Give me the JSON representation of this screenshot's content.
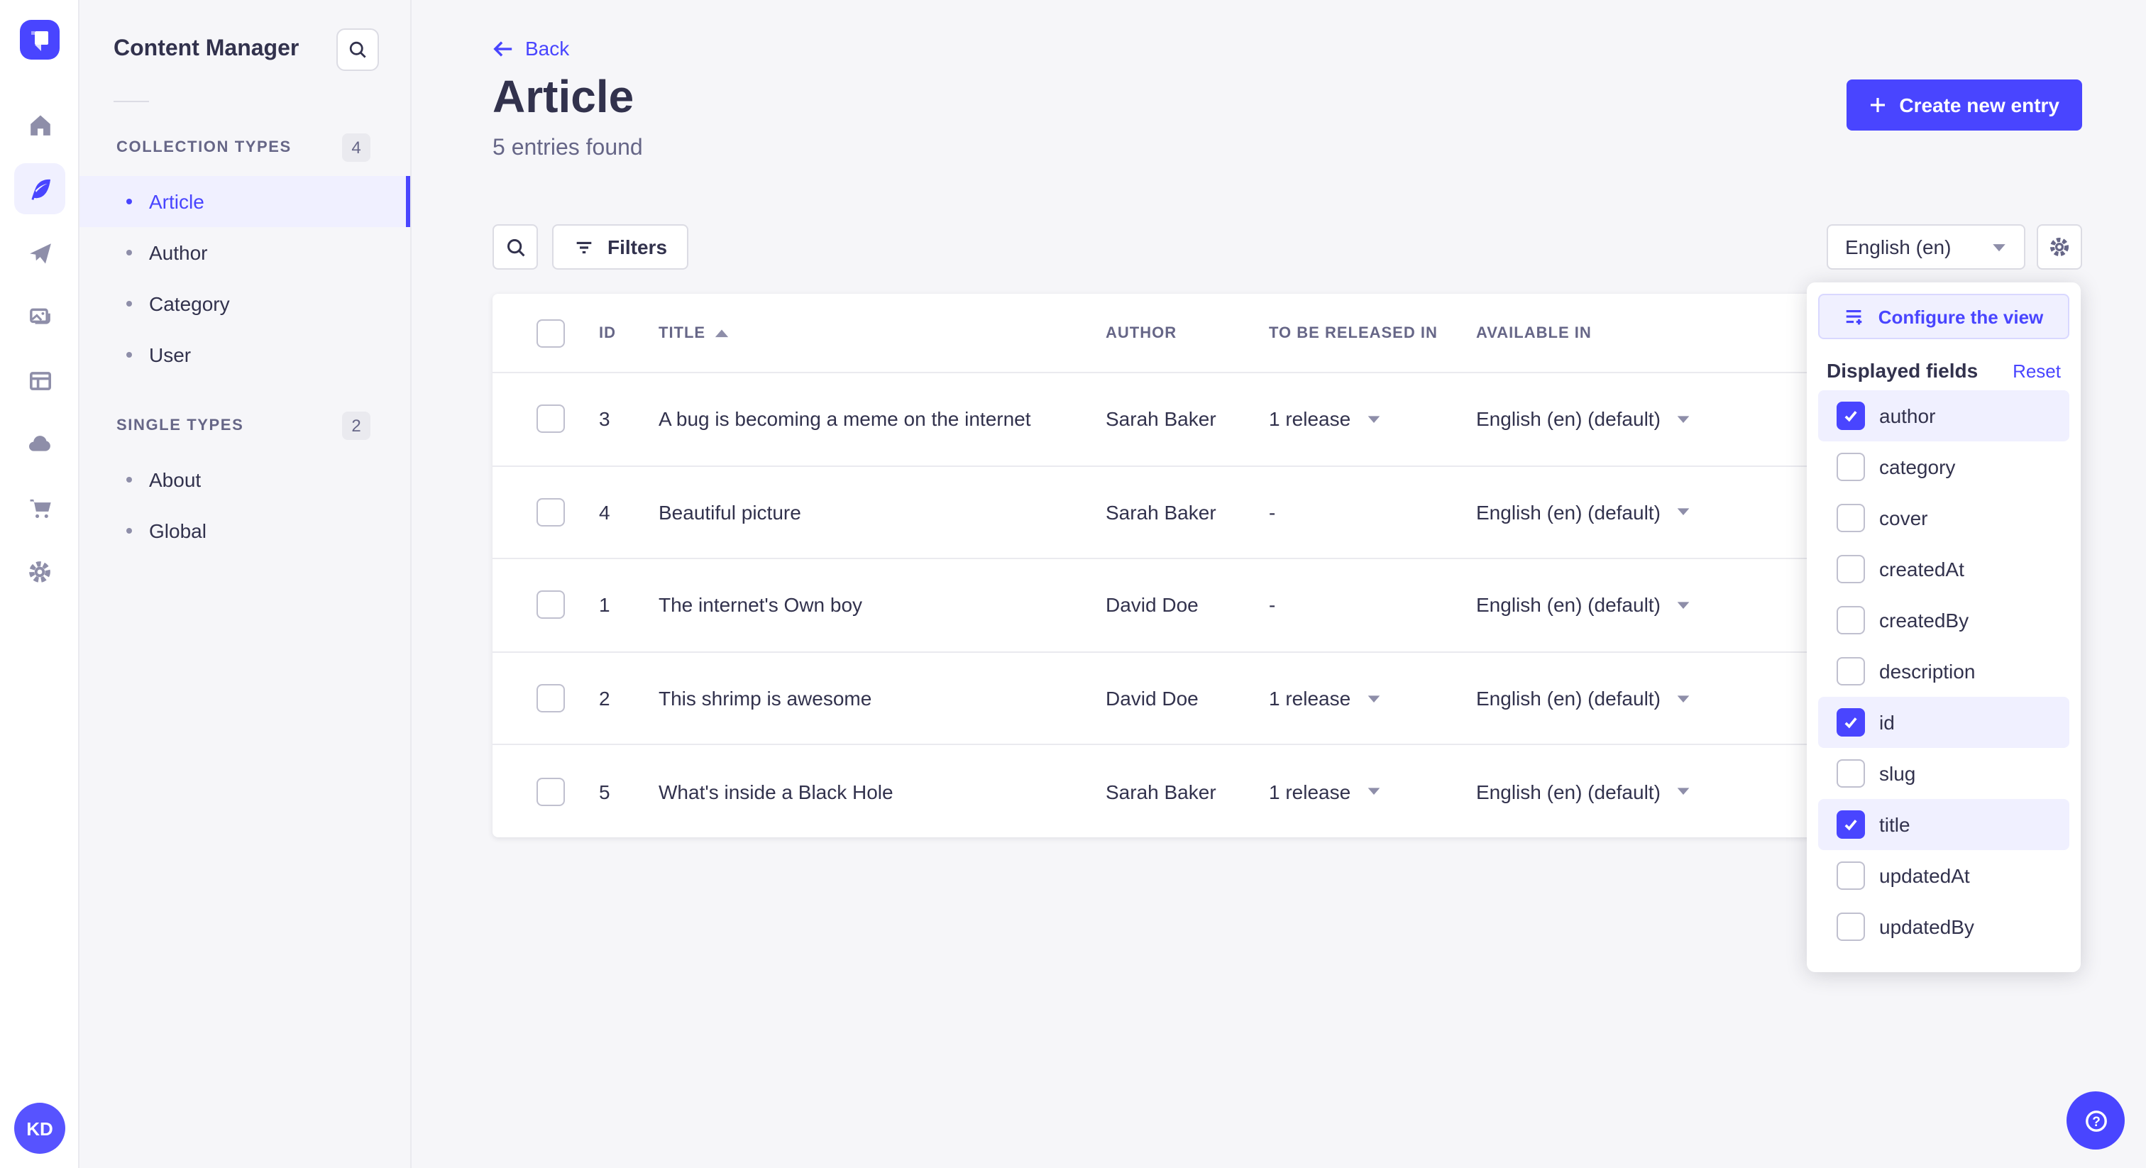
{
  "panel": {
    "title": "Content Manager",
    "collection_types": {
      "label": "COLLECTION TYPES",
      "badge": "4",
      "items": [
        {
          "label": "Article",
          "active": true
        },
        {
          "label": "Author"
        },
        {
          "label": "Category"
        },
        {
          "label": "User"
        }
      ]
    },
    "single_types": {
      "label": "SINGLE TYPES",
      "badge": "2",
      "items": [
        {
          "label": "About"
        },
        {
          "label": "Global"
        }
      ]
    }
  },
  "rail": {
    "icons": [
      "strapi-logo",
      "home",
      "content-manager",
      "releases",
      "media-library",
      "content-type-builder",
      "deploy-cloud",
      "marketplace",
      "settings"
    ]
  },
  "header": {
    "back_label": "Back",
    "title": "Article",
    "subtitle": "5 entries found",
    "create_button": "Create new entry"
  },
  "toolbar": {
    "filters_label": "Filters",
    "locale_value": "English (en)"
  },
  "table": {
    "columns": [
      "ID",
      "TITLE",
      "AUTHOR",
      "TO BE RELEASED IN",
      "AVAILABLE IN"
    ],
    "sorted_column": "TITLE",
    "sort_direction": "ascending",
    "rows": [
      {
        "id": "3",
        "title": "A bug is becoming a meme on the internet",
        "author": "Sarah Baker",
        "releases": "1 release",
        "releases_dropdown": true,
        "available": "English (en) (default)"
      },
      {
        "id": "4",
        "title": "Beautiful picture",
        "author": "Sarah Baker",
        "releases": "-",
        "available": "English (en) (default)"
      },
      {
        "id": "1",
        "title": "The internet's Own boy",
        "author": "David Doe",
        "releases": "-",
        "available": "English (en) (default)"
      },
      {
        "id": "2",
        "title": "This shrimp is awesome",
        "author": "David Doe",
        "releases": "1 release",
        "releases_dropdown": true,
        "available": "English (en) (default)"
      },
      {
        "id": "5",
        "title": "What's inside a Black Hole",
        "author": "Sarah Baker",
        "releases": "1 release",
        "releases_dropdown": true,
        "available": "English (en) (default)"
      }
    ]
  },
  "popover": {
    "configure_button": "Configure the view",
    "fields_label": "Displayed fields",
    "reset_label": "Reset",
    "fields": [
      {
        "label": "author",
        "checked": true
      },
      {
        "label": "category"
      },
      {
        "label": "cover"
      },
      {
        "label": "createdAt"
      },
      {
        "label": "createdBy"
      },
      {
        "label": "description"
      },
      {
        "label": "id",
        "checked": true
      },
      {
        "label": "slug"
      },
      {
        "label": "title",
        "checked": true
      },
      {
        "label": "updatedAt"
      },
      {
        "label": "updatedBy"
      }
    ]
  },
  "user": {
    "initials": "KD"
  },
  "colors": {
    "primary": "#4945ff",
    "primary_light": "#f0f0ff",
    "primary_border": "#d9d8ff",
    "text_dark": "#32324d",
    "text_muted": "#666687",
    "background": "#f6f6f9",
    "border": "#eaeaef"
  }
}
